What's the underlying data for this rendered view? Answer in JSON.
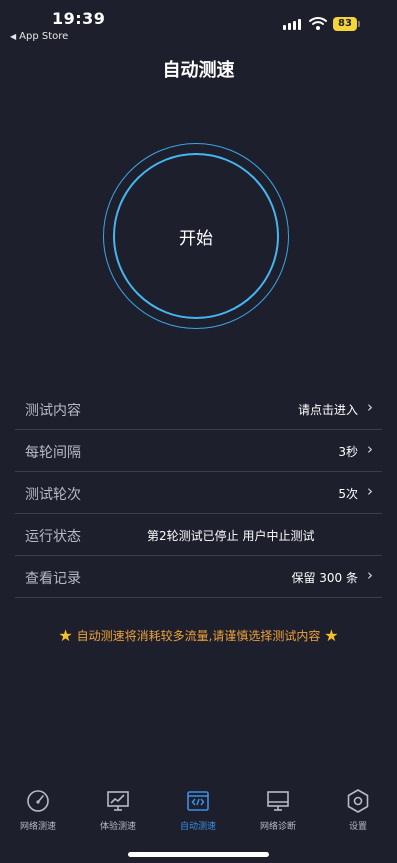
{
  "status": {
    "time": "19:39",
    "back_app": "App Store",
    "battery": "83"
  },
  "header": {
    "title": "自动测速"
  },
  "start_button": {
    "label": "开始"
  },
  "settings": [
    {
      "label": "测试内容",
      "value": "请点击进入"
    },
    {
      "label": "每轮间隔",
      "value": "3秒"
    },
    {
      "label": "测试轮次",
      "value": "5次"
    },
    {
      "label": "运行状态",
      "value": "第2轮测试已停止 用户中止测试"
    },
    {
      "label": "查看记录",
      "value": "保留 300 条"
    }
  ],
  "notice": {
    "text": "自动测速将消耗较多流量,请谨慎选择测试内容"
  },
  "tabs": [
    {
      "label": "网络测速",
      "icon": "speedometer-icon"
    },
    {
      "label": "体验测速",
      "icon": "chart-monitor-icon"
    },
    {
      "label": "自动测速",
      "icon": "code-monitor-icon",
      "active": true
    },
    {
      "label": "网络诊断",
      "icon": "monitor-icon"
    },
    {
      "label": "设置",
      "icon": "hexagon-gear-icon"
    }
  ],
  "colors": {
    "background": "#1d1f2c",
    "ring": "#45b6f2",
    "accent": "#3d8fe6",
    "notice": "#eea23a",
    "battery": "#f5d33b"
  }
}
